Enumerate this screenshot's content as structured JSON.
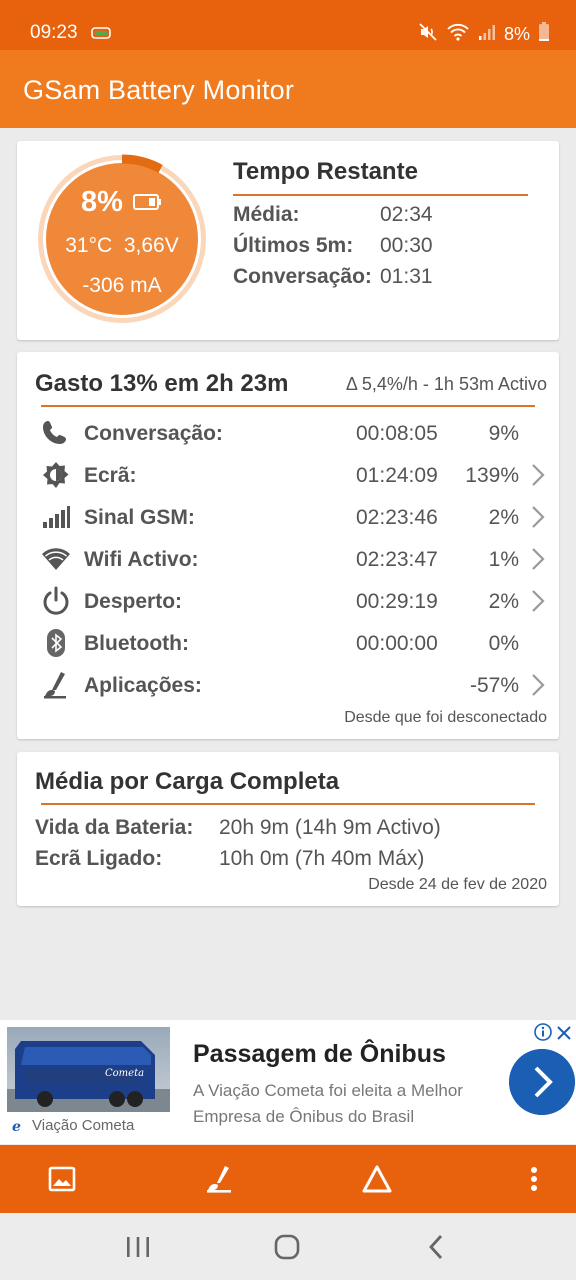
{
  "status_bar": {
    "time": "09:23",
    "battery_pct": "8%",
    "icons": [
      "app-notification-icon",
      "mute-icon",
      "wifi-icon",
      "signal-icon",
      "battery-icon"
    ]
  },
  "app_bar": {
    "title": "GSam Battery Monitor"
  },
  "battery_card": {
    "gauge": {
      "percent": "8%",
      "level": 0.08,
      "temperature": "31°C",
      "voltage": "3,66V",
      "current": "-306 mA"
    },
    "time_remaining": {
      "title": "Tempo Restante",
      "rows": [
        {
          "label": "Média:",
          "value": "02:34"
        },
        {
          "label": "Últimos 5m:",
          "value": "00:30"
        },
        {
          "label": "Conversação:",
          "value": "01:31"
        }
      ]
    }
  },
  "usage_card": {
    "title": "Gasto 13% em 2h 23m",
    "delta": "Δ 5,4%/h - 1h 53m Activo",
    "rows": [
      {
        "icon": "phone-icon",
        "label": "Conversação:",
        "time": "00:08:05",
        "pct": "9%",
        "chevron": false
      },
      {
        "icon": "brightness-icon",
        "label": "Ecrã:",
        "time": "01:24:09",
        "pct": "139%",
        "chevron": true
      },
      {
        "icon": "signal-bars-icon",
        "label": "Sinal GSM:",
        "time": "02:23:46",
        "pct": "2%",
        "chevron": true
      },
      {
        "icon": "wifi-icon",
        "label": "Wifi Activo:",
        "time": "02:23:47",
        "pct": "1%",
        "chevron": true
      },
      {
        "icon": "power-icon",
        "label": "Desperto:",
        "time": "00:29:19",
        "pct": "2%",
        "chevron": true
      },
      {
        "icon": "bluetooth-icon",
        "label": "Bluetooth:",
        "time": "00:00:00",
        "pct": "0%",
        "chevron": false
      },
      {
        "icon": "apps-icon",
        "label": "Aplicações:",
        "time": "",
        "pct": "-57%",
        "chevron": true
      }
    ],
    "footer": "Desde que foi desconectado"
  },
  "average_card": {
    "title": "Média por Carga Completa",
    "rows": [
      {
        "label": "Vida da Bateria:",
        "value": "20h 9m (14h 9m Activo)"
      },
      {
        "label": "Ecrã Ligado:",
        "value": "10h 0m (7h 40m Máx)"
      }
    ],
    "footer": "Desde 24 de fev de 2020"
  },
  "ad": {
    "title": "Passagem de Ônibus",
    "description": "A Viação Cometa foi eleita a Melhor Empresa de Ônibus do Brasil",
    "brand": "Viação Cometa",
    "bus_text": "Cometa"
  },
  "bottom_bar": {
    "buttons": [
      "image-icon",
      "apps-icon",
      "triangle-icon",
      "more-vert-icon"
    ]
  },
  "colors": {
    "status_bar": "#e8620e",
    "app_bar": "#f07a1e",
    "gauge_fill": "#f0883a",
    "accent_line": "#d9752b",
    "ad_button": "#1a5fb4"
  }
}
